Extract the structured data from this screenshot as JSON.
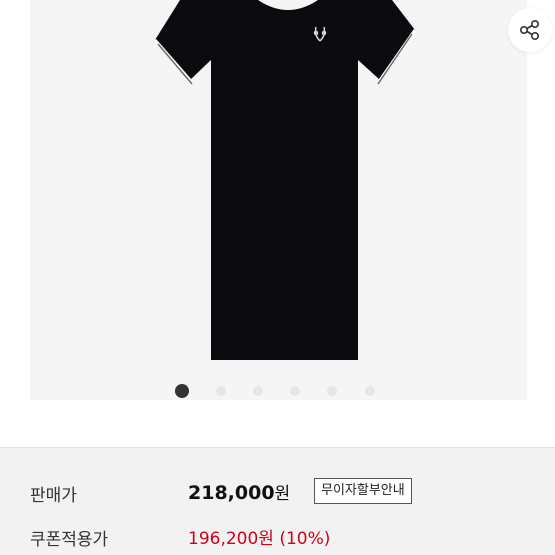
{
  "product": {
    "image_icon": "black-polo-dress-image",
    "share_icon": "share-icon",
    "carousel": {
      "total": 6,
      "active_index": 0
    }
  },
  "pricing": {
    "sale_label": "판매가",
    "sale_price": "218,000",
    "sale_unit": "원",
    "installment_badge": "무이자할부안내",
    "coupon_label": "쿠폰적용가",
    "coupon_price": "196,200원 (10%)"
  },
  "colors": {
    "coupon_price": "#d0021b",
    "dress": "#0b0b0f"
  }
}
